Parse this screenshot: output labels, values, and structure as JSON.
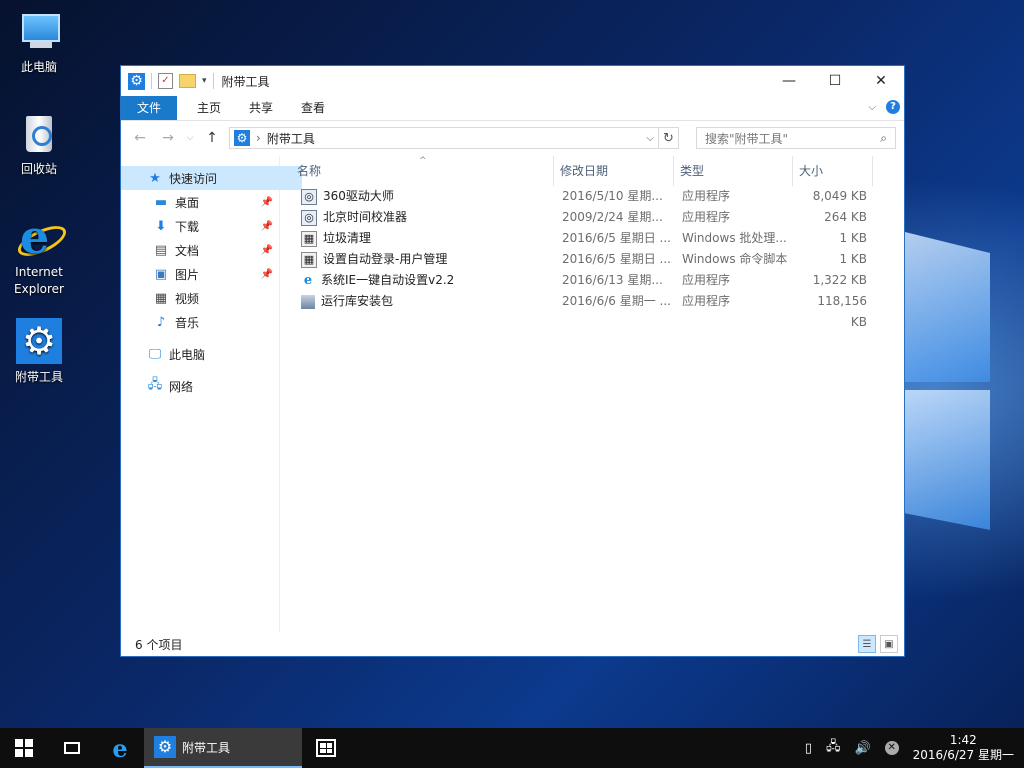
{
  "desktop": {
    "icons": [
      {
        "label": "此电脑"
      },
      {
        "label": "回收站"
      },
      {
        "label": "Internet\nExplorer"
      },
      {
        "label": "附带工具"
      }
    ]
  },
  "window": {
    "title": "附带工具",
    "ribbon_tabs": [
      "文件",
      "主页",
      "共享",
      "查看"
    ],
    "address": "附带工具",
    "search_placeholder": "搜索\"附带工具\"",
    "nav": {
      "quick_access": "快速访问",
      "items": [
        {
          "label": "桌面",
          "icon": "desktop-icon"
        },
        {
          "label": "下载",
          "icon": "download-icon"
        },
        {
          "label": "文档",
          "icon": "document-icon"
        },
        {
          "label": "图片",
          "icon": "picture-icon"
        },
        {
          "label": "视频",
          "icon": "video-icon"
        },
        {
          "label": "音乐",
          "icon": "music-icon"
        }
      ],
      "this_pc": "此电脑",
      "network": "网络"
    },
    "columns": {
      "name": "名称",
      "date": "修改日期",
      "type": "类型",
      "size": "大小"
    },
    "files": [
      {
        "name": "360驱动大师",
        "date": "2016/5/10 星期...",
        "type": "应用程序",
        "size": "8,049 KB",
        "icon": "exe"
      },
      {
        "name": "北京时间校准器",
        "date": "2009/2/24 星期...",
        "type": "应用程序",
        "size": "264 KB",
        "icon": "exe"
      },
      {
        "name": "垃圾清理",
        "date": "2016/6/5 星期日 ...",
        "type": "Windows 批处理...",
        "size": "1 KB",
        "icon": "bat"
      },
      {
        "name": "设置自动登录-用户管理",
        "date": "2016/6/5 星期日 ...",
        "type": "Windows 命令脚本",
        "size": "1 KB",
        "icon": "bat"
      },
      {
        "name": "系统IE一键自动设置v2.2",
        "date": "2016/6/13 星期...",
        "type": "应用程序",
        "size": "1,322 KB",
        "icon": "ie"
      },
      {
        "name": "运行库安装包",
        "date": "2016/6/6 星期一 ...",
        "type": "应用程序",
        "size": "118,156 KB",
        "icon": "pkg"
      }
    ],
    "status": "6 个项目"
  },
  "taskbar": {
    "app_label": "附带工具",
    "time": "1:42",
    "date": "2016/6/27 星期一"
  },
  "colors": {
    "accent": "#1979ca",
    "selection": "#cce8ff"
  }
}
